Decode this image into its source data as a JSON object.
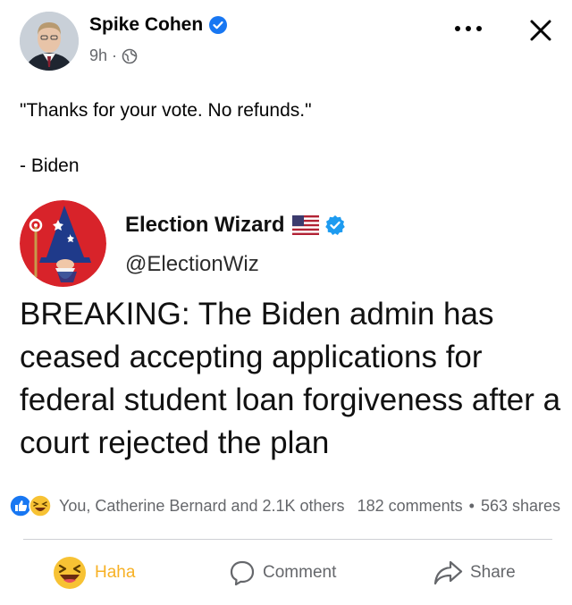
{
  "post": {
    "author": "Spike Cohen",
    "time": "9h",
    "meta_separator": "·",
    "caption_line1": "\"Thanks for your vote. No refunds.\"",
    "caption_line2": "- Biden"
  },
  "tweet": {
    "name": "Election Wizard",
    "handle": "@ElectionWiz",
    "text": "BREAKING: The Biden admin has ceased accepting applications for federal student loan forgiveness after a court rejected the plan"
  },
  "reactions": {
    "summary": "You, Catherine Bernard and 2.1K others",
    "comments": "182 comments",
    "separator": "•",
    "shares": "563 shares"
  },
  "actions": {
    "haha": "Haha",
    "comment": "Comment",
    "share": "Share"
  },
  "colors": {
    "verified_blue": "#1877f2",
    "haha_yellow": "#f7b125",
    "muted_text": "#65676b"
  }
}
